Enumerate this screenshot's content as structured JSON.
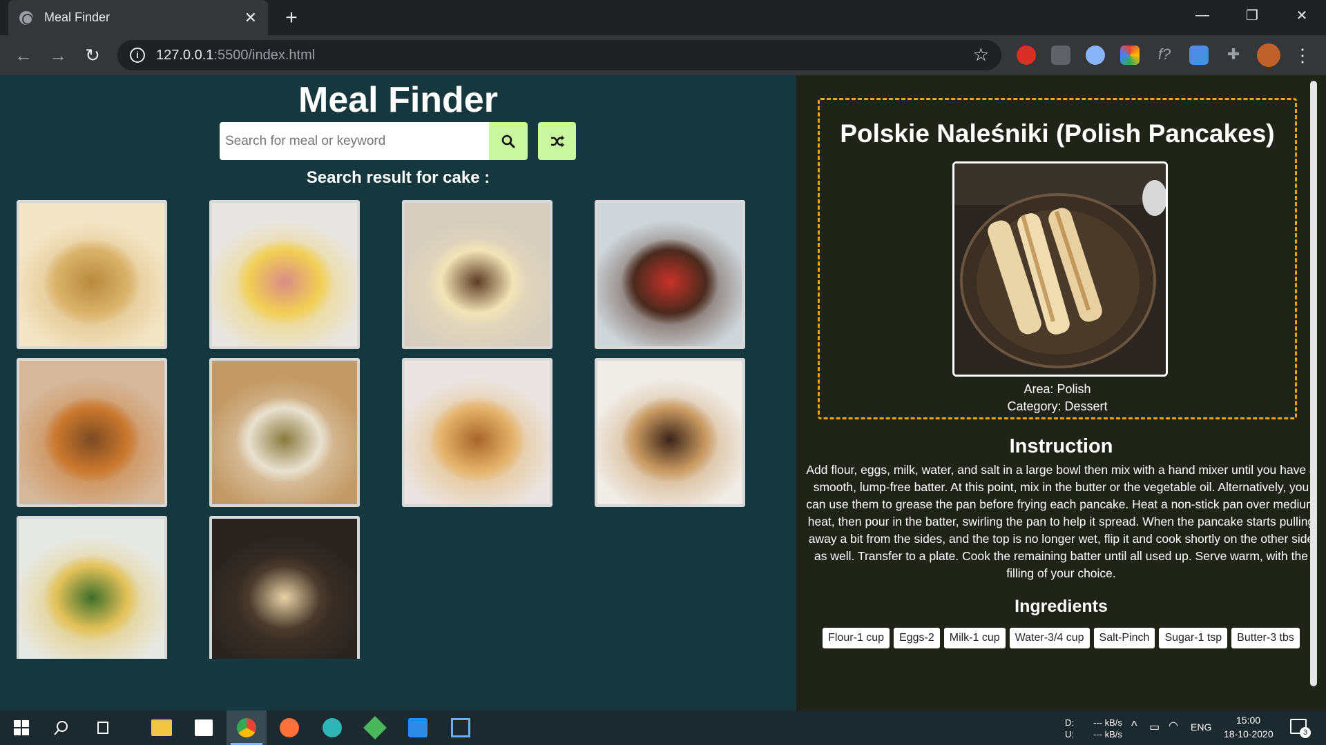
{
  "browser": {
    "tab_title": "Meal Finder",
    "url_host": "127.0.0.1",
    "url_path": ":5500/index.html"
  },
  "app": {
    "title": "Meal Finder",
    "search_placeholder": "Search for meal or keyword",
    "result_heading": "Search result for cake :",
    "results": [
      {
        "meal": "pancake stack with bananas",
        "colors": [
          "#f3e6c8",
          "#d9b26a",
          "#b88a3e"
        ]
      },
      {
        "meal": "battenberg cake",
        "colors": [
          "#e8e6e2",
          "#f1cf55",
          "#d98d86"
        ]
      },
      {
        "meal": "cheesecake slice",
        "colors": [
          "#d6cdbf",
          "#f2e4b8",
          "#5e3c24"
        ]
      },
      {
        "meal": "chocolate bundt cake with strawberries",
        "colors": [
          "#cfd6da",
          "#4a2a1e",
          "#c8322a"
        ]
      },
      {
        "meal": "syrup sponge cake with star anise",
        "colors": [
          "#d5b79a",
          "#c9782e",
          "#7c4a22"
        ]
      },
      {
        "meal": "quiche",
        "colors": [
          "#c39a66",
          "#e9e1d0",
          "#8a7a3f"
        ]
      },
      {
        "meal": "caramel popcorn cheesecake",
        "colors": [
          "#eae5e2",
          "#e4b36a",
          "#a8652a"
        ]
      },
      {
        "meal": "chocolate peanut butter pie",
        "colors": [
          "#f0ede8",
          "#c89a62",
          "#3b2418"
        ]
      },
      {
        "meal": "frittata with salad",
        "colors": [
          "#e7e9e4",
          "#e2c25a",
          "#3f6e2a"
        ]
      },
      {
        "meal": "polish pancakes",
        "colors": [
          "#2a2420",
          "#4a3a2c",
          "#e8d3a8"
        ]
      }
    ]
  },
  "detail": {
    "title": "Polskie Naleśniki (Polish Pancakes)",
    "area": "Area: Polish",
    "category": "Category: Dessert",
    "instruction_heading": "Instruction",
    "instructions": "Add flour, eggs, milk, water, and salt in a large bowl then mix with a hand mixer until you have a smooth, lump-free batter. At this point, mix in the butter or the vegetable oil. Alternatively, you can use them to grease the pan before frying each pancake. Heat a non-stick pan over medium heat, then pour in the batter, swirling the pan to help it spread. When the pancake starts pulling away a bit from the sides, and the top is no longer wet, flip it and cook shortly on the other side as well. Transfer to a plate. Cook the remaining batter until all used up. Serve warm, with the filling of your choice.",
    "ingredients_heading": "Ingredients",
    "ingredients": [
      "Flour-1 cup",
      "Eggs-2",
      "Milk-1 cup",
      "Water-3/4 cup",
      "Salt-Pinch",
      "Sugar-1 tsp",
      "Butter-3 tbs"
    ]
  },
  "taskbar": {
    "tray_drive_d": "D:",
    "tray_drive_u": "U:",
    "tray_rate_down": "--- kB/s",
    "tray_rate_up": "--- kB/s",
    "language": "ENG",
    "time": "15:00",
    "date": "18-10-2020",
    "notification_count": "3"
  },
  "colors": {
    "left_bg": "#15373d",
    "right_bg": "#202418",
    "accent_button": "#c8f7a0",
    "dashed_border": "#f0a500"
  }
}
